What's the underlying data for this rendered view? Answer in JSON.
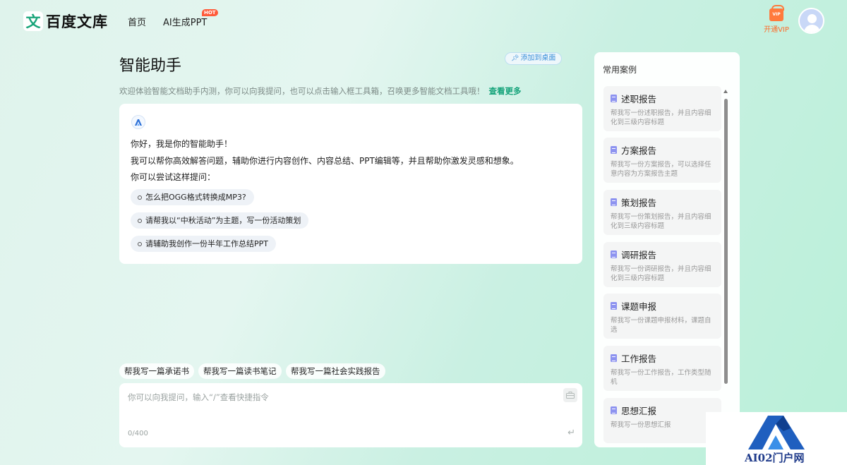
{
  "header": {
    "logo_glyph": "文",
    "logo_text": "百度文库",
    "nav_home": "首页",
    "nav_ai_ppt": "AI生成PPT",
    "hot_badge": "HOT",
    "vip_label": "开通VIP",
    "vip_icon_text": "VIP"
  },
  "main": {
    "title": "智能助手",
    "pin_label": "添加到桌面",
    "welcome_text": "欢迎体验智能文档助手内测，你可以向我提问，也可以点击输入框工具箱，召唤更多智能文档工具哦！",
    "see_more": "查看更多",
    "greeting": [
      "你好，我是你的智能助手！",
      "我可以帮你高效解答问题，辅助你进行内容创作、内容总结、PPT编辑等，并且帮助你激发灵感和想象。",
      "你可以尝试这样提问："
    ],
    "suggestions": [
      "怎么把OGG格式转换成MP3?",
      "请帮我以“中秋活动”为主题，写一份活动策划",
      "请辅助我创作一份半年工作总结PPT"
    ],
    "quick_chips": [
      "帮我写一篇承诺书",
      "帮我写一篇读书笔记",
      "帮我写一篇社会实践报告"
    ],
    "input_placeholder": "你可以向我提问，输入“/”查看快捷指令",
    "char_counter": "0/400"
  },
  "side": {
    "title": "常用案例",
    "cases": [
      {
        "title": "述职报告",
        "desc": "帮我写一份述职报告，并且内容细化到三级内容标题"
      },
      {
        "title": "方案报告",
        "desc": "帮我写一份方案报告，可以选择任意内容为方案报告主题"
      },
      {
        "title": "策划报告",
        "desc": "帮我写一份策划报告，并且内容细化到三级内容标题"
      },
      {
        "title": "调研报告",
        "desc": "帮我写一份调研报告，并且内容细化到三级内容标题"
      },
      {
        "title": "课题申报",
        "desc": "帮我写一份课题申报材料，课题自选"
      },
      {
        "title": "工作报告",
        "desc": "帮我写一份工作报告，工作类型随机"
      },
      {
        "title": "思想汇报",
        "desc": "帮我写一份思想汇报"
      }
    ]
  },
  "watermark": {
    "text": "AI02门户网"
  },
  "colors": {
    "accent_green": "#15a37a",
    "vip_orange": "#ff6a28",
    "hot_red": "#ff5b3a",
    "link_blue": "#3a8fd9"
  }
}
